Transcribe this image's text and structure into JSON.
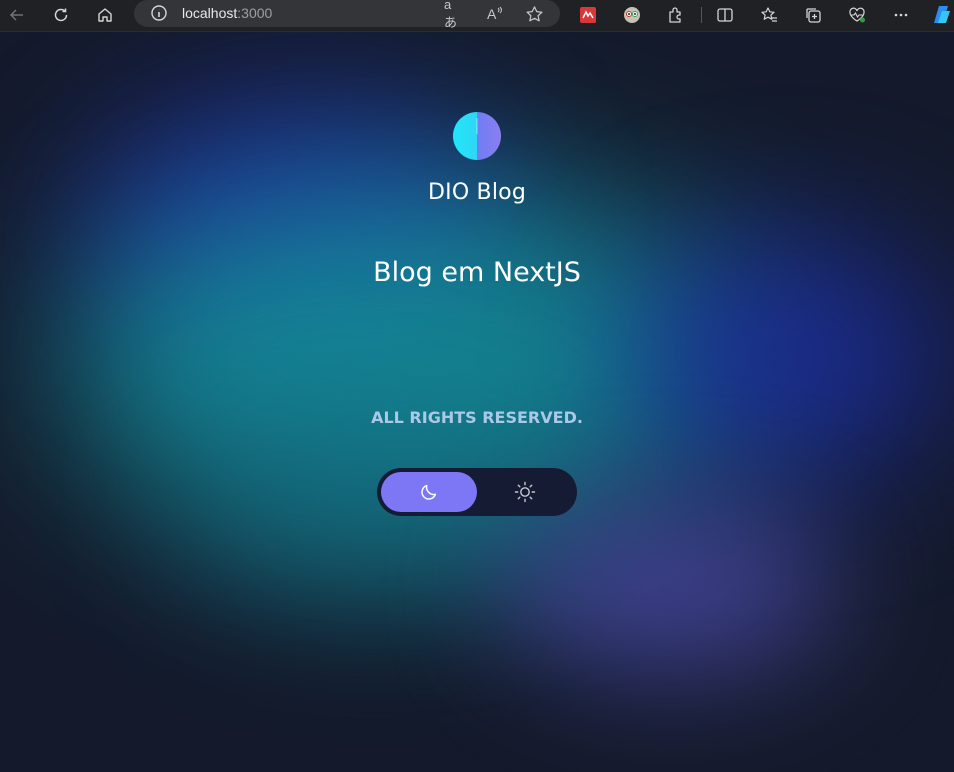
{
  "browser": {
    "url_host": "localhost",
    "url_port": ":3000",
    "translate_icon_text": "aあ",
    "read_aloud_icon_text": "A"
  },
  "page": {
    "site_name": "DIO Blog",
    "headline": "Blog em NextJS",
    "footer": "ALL RIGHTS RESERVED.",
    "theme_toggle": {
      "options": [
        "dark-mode",
        "light-mode"
      ],
      "selected": "dark-mode",
      "selected_color": "#7e77f5"
    }
  },
  "colors": {
    "background": "#141a2b",
    "logo_left": "#21e6f8",
    "logo_right": "#8b7ef0",
    "footer_text": "#a9c9e6"
  }
}
